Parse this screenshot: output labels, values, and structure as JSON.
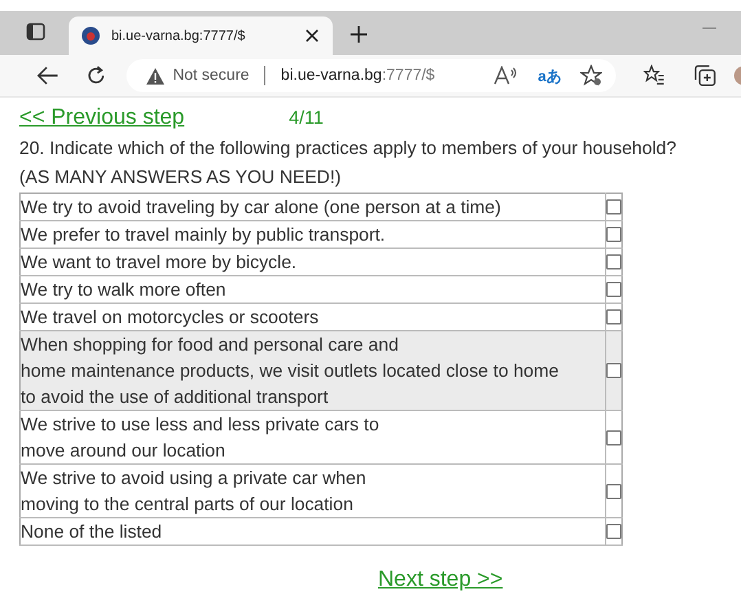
{
  "browser": {
    "tab_title": "bi.ue-varna.bg:7777/$",
    "security": "Not secure",
    "url_host": "bi.ue-varna.bg",
    "url_path": ":7777/$",
    "translate_glyph": "aあ"
  },
  "nav": {
    "previous": "<< Previous step",
    "progress": "4/11",
    "next": "Next step >>"
  },
  "question": "20. Indicate which of the following practices apply to members of your household?",
  "instruction": "(AS MANY ANSWERS AS YOU NEED!)",
  "options": [
    {
      "lines": [
        "We try to avoid traveling by car alone (one person at a time)"
      ],
      "checked": false,
      "highlighted": false
    },
    {
      "lines": [
        "We prefer to travel mainly by public transport."
      ],
      "checked": false,
      "highlighted": false
    },
    {
      "lines": [
        "We want to travel more by bicycle."
      ],
      "checked": false,
      "highlighted": false
    },
    {
      "lines": [
        "We try to walk more often"
      ],
      "checked": false,
      "highlighted": false
    },
    {
      "lines": [
        "We travel on motorcycles or scooters"
      ],
      "checked": false,
      "highlighted": false
    },
    {
      "lines": [
        "When shopping for food and personal care and",
        "home maintenance products, we visit outlets located close to home",
        "to avoid the use of additional transport"
      ],
      "checked": false,
      "highlighted": true
    },
    {
      "lines": [
        "We strive to use less and less private cars to",
        "move around our location"
      ],
      "checked": false,
      "highlighted": false
    },
    {
      "lines": [
        "We strive to avoid using a private car when",
        "moving to the central parts of our location"
      ],
      "checked": false,
      "highlighted": false
    },
    {
      "lines": [
        "None of the listed"
      ],
      "checked": false,
      "highlighted": false
    }
  ]
}
